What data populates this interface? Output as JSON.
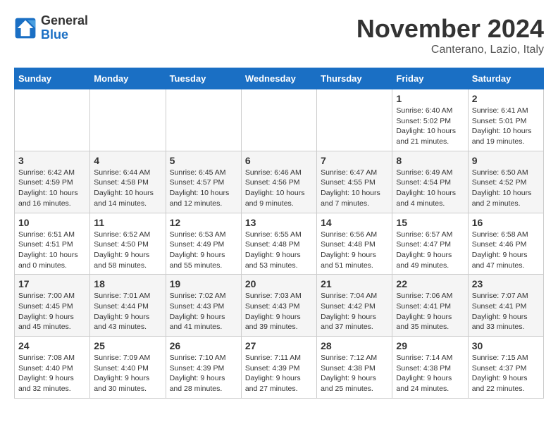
{
  "logo": {
    "general": "General",
    "blue": "Blue"
  },
  "title": "November 2024",
  "subtitle": "Canterano, Lazio, Italy",
  "days_header": [
    "Sunday",
    "Monday",
    "Tuesday",
    "Wednesday",
    "Thursday",
    "Friday",
    "Saturday"
  ],
  "weeks": [
    [
      {
        "day": "",
        "info": ""
      },
      {
        "day": "",
        "info": ""
      },
      {
        "day": "",
        "info": ""
      },
      {
        "day": "",
        "info": ""
      },
      {
        "day": "",
        "info": ""
      },
      {
        "day": "1",
        "info": "Sunrise: 6:40 AM\nSunset: 5:02 PM\nDaylight: 10 hours\nand 21 minutes."
      },
      {
        "day": "2",
        "info": "Sunrise: 6:41 AM\nSunset: 5:01 PM\nDaylight: 10 hours\nand 19 minutes."
      }
    ],
    [
      {
        "day": "3",
        "info": "Sunrise: 6:42 AM\nSunset: 4:59 PM\nDaylight: 10 hours\nand 16 minutes."
      },
      {
        "day": "4",
        "info": "Sunrise: 6:44 AM\nSunset: 4:58 PM\nDaylight: 10 hours\nand 14 minutes."
      },
      {
        "day": "5",
        "info": "Sunrise: 6:45 AM\nSunset: 4:57 PM\nDaylight: 10 hours\nand 12 minutes."
      },
      {
        "day": "6",
        "info": "Sunrise: 6:46 AM\nSunset: 4:56 PM\nDaylight: 10 hours\nand 9 minutes."
      },
      {
        "day": "7",
        "info": "Sunrise: 6:47 AM\nSunset: 4:55 PM\nDaylight: 10 hours\nand 7 minutes."
      },
      {
        "day": "8",
        "info": "Sunrise: 6:49 AM\nSunset: 4:54 PM\nDaylight: 10 hours\nand 4 minutes."
      },
      {
        "day": "9",
        "info": "Sunrise: 6:50 AM\nSunset: 4:52 PM\nDaylight: 10 hours\nand 2 minutes."
      }
    ],
    [
      {
        "day": "10",
        "info": "Sunrise: 6:51 AM\nSunset: 4:51 PM\nDaylight: 10 hours\nand 0 minutes."
      },
      {
        "day": "11",
        "info": "Sunrise: 6:52 AM\nSunset: 4:50 PM\nDaylight: 9 hours\nand 58 minutes."
      },
      {
        "day": "12",
        "info": "Sunrise: 6:53 AM\nSunset: 4:49 PM\nDaylight: 9 hours\nand 55 minutes."
      },
      {
        "day": "13",
        "info": "Sunrise: 6:55 AM\nSunset: 4:48 PM\nDaylight: 9 hours\nand 53 minutes."
      },
      {
        "day": "14",
        "info": "Sunrise: 6:56 AM\nSunset: 4:48 PM\nDaylight: 9 hours\nand 51 minutes."
      },
      {
        "day": "15",
        "info": "Sunrise: 6:57 AM\nSunset: 4:47 PM\nDaylight: 9 hours\nand 49 minutes."
      },
      {
        "day": "16",
        "info": "Sunrise: 6:58 AM\nSunset: 4:46 PM\nDaylight: 9 hours\nand 47 minutes."
      }
    ],
    [
      {
        "day": "17",
        "info": "Sunrise: 7:00 AM\nSunset: 4:45 PM\nDaylight: 9 hours\nand 45 minutes."
      },
      {
        "day": "18",
        "info": "Sunrise: 7:01 AM\nSunset: 4:44 PM\nDaylight: 9 hours\nand 43 minutes."
      },
      {
        "day": "19",
        "info": "Sunrise: 7:02 AM\nSunset: 4:43 PM\nDaylight: 9 hours\nand 41 minutes."
      },
      {
        "day": "20",
        "info": "Sunrise: 7:03 AM\nSunset: 4:43 PM\nDaylight: 9 hours\nand 39 minutes."
      },
      {
        "day": "21",
        "info": "Sunrise: 7:04 AM\nSunset: 4:42 PM\nDaylight: 9 hours\nand 37 minutes."
      },
      {
        "day": "22",
        "info": "Sunrise: 7:06 AM\nSunset: 4:41 PM\nDaylight: 9 hours\nand 35 minutes."
      },
      {
        "day": "23",
        "info": "Sunrise: 7:07 AM\nSunset: 4:41 PM\nDaylight: 9 hours\nand 33 minutes."
      }
    ],
    [
      {
        "day": "24",
        "info": "Sunrise: 7:08 AM\nSunset: 4:40 PM\nDaylight: 9 hours\nand 32 minutes."
      },
      {
        "day": "25",
        "info": "Sunrise: 7:09 AM\nSunset: 4:40 PM\nDaylight: 9 hours\nand 30 minutes."
      },
      {
        "day": "26",
        "info": "Sunrise: 7:10 AM\nSunset: 4:39 PM\nDaylight: 9 hours\nand 28 minutes."
      },
      {
        "day": "27",
        "info": "Sunrise: 7:11 AM\nSunset: 4:39 PM\nDaylight: 9 hours\nand 27 minutes."
      },
      {
        "day": "28",
        "info": "Sunrise: 7:12 AM\nSunset: 4:38 PM\nDaylight: 9 hours\nand 25 minutes."
      },
      {
        "day": "29",
        "info": "Sunrise: 7:14 AM\nSunset: 4:38 PM\nDaylight: 9 hours\nand 24 minutes."
      },
      {
        "day": "30",
        "info": "Sunrise: 7:15 AM\nSunset: 4:37 PM\nDaylight: 9 hours\nand 22 minutes."
      }
    ]
  ]
}
